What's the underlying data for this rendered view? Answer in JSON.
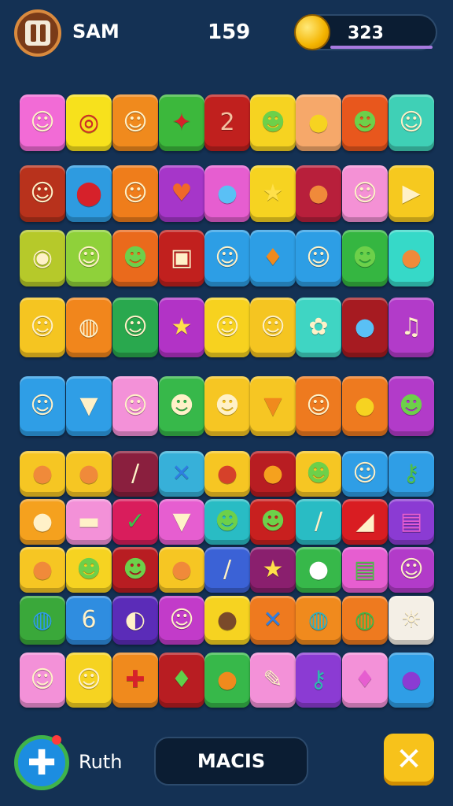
{
  "header": {
    "player_name": "SAM",
    "score": "159",
    "coins": "323"
  },
  "footer": {
    "player_name": "Ruth",
    "action_label": "MACIS"
  },
  "icons": {
    "pause": "pause-icon",
    "coin": "coin-icon",
    "add": "plus-icon",
    "close": "close-icon"
  },
  "board": {
    "rows": [
      [
        {
          "color": "#f26bd6",
          "icon": "smile-face"
        },
        {
          "color": "#f7e11c",
          "icon": "red-target"
        },
        {
          "color": "#f08a1d",
          "icon": "smile-face"
        },
        {
          "color": "#3cb83c",
          "icon": "red-star"
        },
        {
          "color": "#c0201e",
          "icon": "number-two"
        },
        {
          "color": "#f6d321",
          "icon": "green-monster"
        },
        {
          "color": "#f6a86a",
          "icon": "yellow-drop"
        },
        {
          "color": "#e8571d",
          "icon": "green-face"
        },
        {
          "color": "#3fd0b6",
          "icon": "orange-fish"
        }
      ],
      [
        {
          "color": "#b8321c",
          "icon": "person"
        },
        {
          "color": "#2e9be0",
          "icon": "map-pin"
        },
        {
          "color": "#ef7d1b",
          "icon": "smile-face"
        },
        {
          "color": "#a636c9",
          "icon": "heart"
        },
        {
          "color": "#e65ed0",
          "icon": "blue-drop"
        },
        {
          "color": "#f6d321",
          "icon": "star-face"
        },
        {
          "color": "#b81f3b",
          "icon": "orange-face"
        },
        {
          "color": "#f491d5",
          "icon": "ghost"
        },
        {
          "color": "#f6c91f",
          "icon": "play-button"
        }
      ],
      [
        {
          "color": "#b6c92a",
          "icon": "swirl"
        },
        {
          "color": "#8fd13a",
          "icon": "cat-face"
        },
        {
          "color": "#ea6a1c",
          "icon": "green-monster"
        },
        {
          "color": "#c1201e",
          "icon": "camera"
        },
        {
          "color": "#2d9ee5",
          "icon": "baby-face"
        },
        {
          "color": "#2d9ee5",
          "icon": "orange-leaf"
        },
        {
          "color": "#2d9ee5",
          "icon": "person"
        },
        {
          "color": "#35b641",
          "icon": "green-monster"
        },
        {
          "color": "#36d9c8",
          "icon": "orange-face"
        }
      ],
      [
        {
          "color": "#f5c521",
          "icon": "person"
        },
        {
          "color": "#f1861c",
          "icon": "lollipop"
        },
        {
          "color": "#29a84e",
          "icon": "person"
        },
        {
          "color": "#b233c6",
          "icon": "star"
        },
        {
          "color": "#f7d21f",
          "icon": "person"
        },
        {
          "color": "#f5c521",
          "icon": "cowboy"
        },
        {
          "color": "#3fd5c3",
          "icon": "blue-flower"
        },
        {
          "color": "#a61b21",
          "icon": "blue-drop"
        },
        {
          "color": "#b23bc9",
          "icon": "music-note"
        }
      ],
      [
        {
          "color": "#2f9ee6",
          "icon": "cowboy"
        },
        {
          "color": "#2f9ee6",
          "icon": "ice-cream"
        },
        {
          "color": "#f391d8",
          "icon": "baby-face"
        },
        {
          "color": "#37b84a",
          "icon": "robot"
        },
        {
          "color": "#f6c623",
          "icon": "robot"
        },
        {
          "color": "#f6c623",
          "icon": "carrot"
        },
        {
          "color": "#ee7a1f",
          "icon": "baby-face"
        },
        {
          "color": "#ee7a1f",
          "icon": "yellow-balloon"
        },
        {
          "color": "#b23bc9",
          "icon": "green-monster"
        }
      ],
      [
        {
          "color": "#f6c623",
          "icon": "orange-face"
        },
        {
          "color": "#f6c623",
          "icon": "orange-face"
        },
        {
          "color": "#8a1f3e",
          "icon": "crayon"
        },
        {
          "color": "#37b0d9",
          "icon": "blue-x"
        },
        {
          "color": "#f6c623",
          "icon": "tomato"
        },
        {
          "color": "#b81d22",
          "icon": "orange-balloon"
        },
        {
          "color": "#f6c623",
          "icon": "green-monster"
        },
        {
          "color": "#2f9ee6",
          "icon": "blue-face"
        },
        {
          "color": "#2f9ee6",
          "icon": "green-key"
        }
      ],
      [
        {
          "color": "#f5a11e",
          "icon": "red-fruit"
        },
        {
          "color": "#f391d8",
          "icon": "cake"
        },
        {
          "color": "#d91d5c",
          "icon": "check"
        },
        {
          "color": "#e65ed0",
          "icon": "bucket"
        },
        {
          "color": "#29bcc4",
          "icon": "green-face"
        },
        {
          "color": "#c8201f",
          "icon": "green-face"
        },
        {
          "color": "#29bcc4",
          "icon": "pencil"
        },
        {
          "color": "#d91d22",
          "icon": "cheese"
        },
        {
          "color": "#8b3bd3",
          "icon": "candy"
        }
      ],
      [
        {
          "color": "#f6c623",
          "icon": "orange-face"
        },
        {
          "color": "#f6d321",
          "icon": "green-face"
        },
        {
          "color": "#b81d22",
          "icon": "green-face"
        },
        {
          "color": "#f6c623",
          "icon": "orange-face"
        },
        {
          "color": "#3b62d6",
          "icon": "purple-leaf"
        },
        {
          "color": "#8a1f6e",
          "icon": "star"
        },
        {
          "color": "#37b84a",
          "icon": "white-drop"
        },
        {
          "color": "#e65ed0",
          "icon": "money"
        },
        {
          "color": "#b23bc9",
          "icon": "person"
        }
      ],
      [
        {
          "color": "#3aa83a",
          "icon": "blue-sphere"
        },
        {
          "color": "#2f8de0",
          "icon": "number-six"
        },
        {
          "color": "#5b2cb8",
          "icon": "blue-ball"
        },
        {
          "color": "#c23bc9",
          "icon": "smile-face"
        },
        {
          "color": "#f6d321",
          "icon": "brown-ball"
        },
        {
          "color": "#ee7a1f",
          "icon": "blue-x"
        },
        {
          "color": "#f08a1d",
          "icon": "striped-ball"
        },
        {
          "color": "#ee7a1f",
          "icon": "green-ball"
        },
        {
          "color": "#f4efe6",
          "icon": "sun-face"
        }
      ],
      [
        {
          "color": "#f391d8",
          "icon": "cowboy"
        },
        {
          "color": "#f6d321",
          "icon": "person"
        },
        {
          "color": "#f08a1d",
          "icon": "red-cross"
        },
        {
          "color": "#b81d22",
          "icon": "green-leaf"
        },
        {
          "color": "#37b84a",
          "icon": "orange-fruit"
        },
        {
          "color": "#f391d8",
          "icon": "wand"
        },
        {
          "color": "#8b3bd3",
          "icon": "teal-key"
        },
        {
          "color": "#f391d8",
          "icon": "pink-leaf"
        },
        {
          "color": "#2f9ee6",
          "icon": "purple-face"
        }
      ]
    ]
  }
}
